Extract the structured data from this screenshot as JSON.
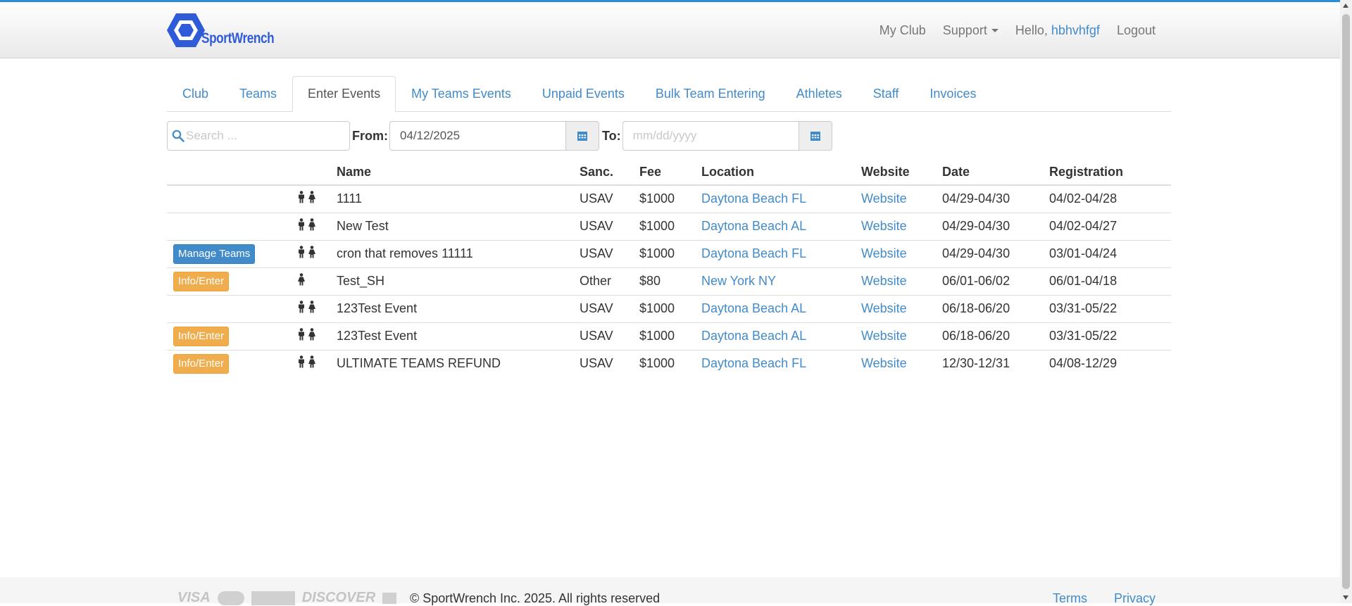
{
  "brand": {
    "name": "SportWrench",
    "color": "#2f5bd9"
  },
  "navbar": {
    "my_club": "My Club",
    "support": "Support",
    "hello_prefix": "Hello,",
    "username": "hbhvhfgf",
    "logout": "Logout"
  },
  "tabs": [
    {
      "label": "Club",
      "active": false
    },
    {
      "label": "Teams",
      "active": false
    },
    {
      "label": "Enter Events",
      "active": true
    },
    {
      "label": "My Teams Events",
      "active": false
    },
    {
      "label": "Unpaid Events",
      "active": false
    },
    {
      "label": "Bulk Team Entering",
      "active": false
    },
    {
      "label": "Athletes",
      "active": false
    },
    {
      "label": "Staff",
      "active": false
    },
    {
      "label": "Invoices",
      "active": false
    }
  ],
  "filters": {
    "search_placeholder": "Search ...",
    "from_label": "From:",
    "from_value": "04/12/2025",
    "to_label": "To:",
    "to_placeholder": "mm/dd/yyyy"
  },
  "table": {
    "headers": {
      "name": "Name",
      "sanc": "Sanc.",
      "fee": "Fee",
      "location": "Location",
      "website": "Website",
      "date": "Date",
      "registration": "Registration"
    },
    "rows": [
      {
        "action": "",
        "action_style": "",
        "genders": "male-female",
        "name": "1111",
        "sanc": "USAV",
        "fee": "$1000",
        "location": "Daytona Beach FL",
        "website": "Website",
        "date": "04/29-04/30",
        "registration": "04/02-04/28"
      },
      {
        "action": "",
        "action_style": "",
        "genders": "male-female",
        "name": "New Test",
        "sanc": "USAV",
        "fee": "$1000",
        "location": "Daytona Beach AL",
        "website": "Website",
        "date": "04/29-04/30",
        "registration": "04/02-04/27"
      },
      {
        "action": "Manage Teams",
        "action_style": "primary",
        "genders": "male-female",
        "name": "cron that removes 11111",
        "sanc": "USAV",
        "fee": "$1000",
        "location": "Daytona Beach FL",
        "website": "Website",
        "date": "04/29-04/30",
        "registration": "03/01-04/24"
      },
      {
        "action": "Info/Enter",
        "action_style": "warning",
        "genders": "female",
        "name": "Test_SH",
        "sanc": "Other",
        "fee": "$80",
        "location": "New York NY",
        "website": "Website",
        "date": "06/01-06/02",
        "registration": "06/01-04/18"
      },
      {
        "action": "",
        "action_style": "",
        "genders": "male-female",
        "name": "123Test Event",
        "sanc": "USAV",
        "fee": "$1000",
        "location": "Daytona Beach AL",
        "website": "Website",
        "date": "06/18-06/20",
        "registration": "03/31-05/22"
      },
      {
        "action": "Info/Enter",
        "action_style": "warning",
        "genders": "male-female",
        "name": "123Test Event",
        "sanc": "USAV",
        "fee": "$1000",
        "location": "Daytona Beach AL",
        "website": "Website",
        "date": "06/18-06/20",
        "registration": "03/31-05/22"
      },
      {
        "action": "Info/Enter",
        "action_style": "warning",
        "genders": "male-female",
        "name": "ULTIMATE TEAMS REFUND",
        "sanc": "USAV",
        "fee": "$1000",
        "location": "Daytona Beach FL",
        "website": "Website",
        "date": "12/30-12/31",
        "registration": "04/08-12/29"
      }
    ]
  },
  "footer": {
    "cards": [
      "VISA",
      "MasterCard",
      "AMERICAN EXPRESS",
      "DISCOVER",
      "card-icon"
    ],
    "copyright": "© SportWrench Inc. 2025. All rights reserved",
    "terms": "Terms",
    "privacy": "Privacy"
  },
  "colors": {
    "link": "#428bca",
    "primary_btn": "#428bca",
    "warning_btn": "#f0ad4e",
    "top_bar": "#2a8fd8"
  }
}
